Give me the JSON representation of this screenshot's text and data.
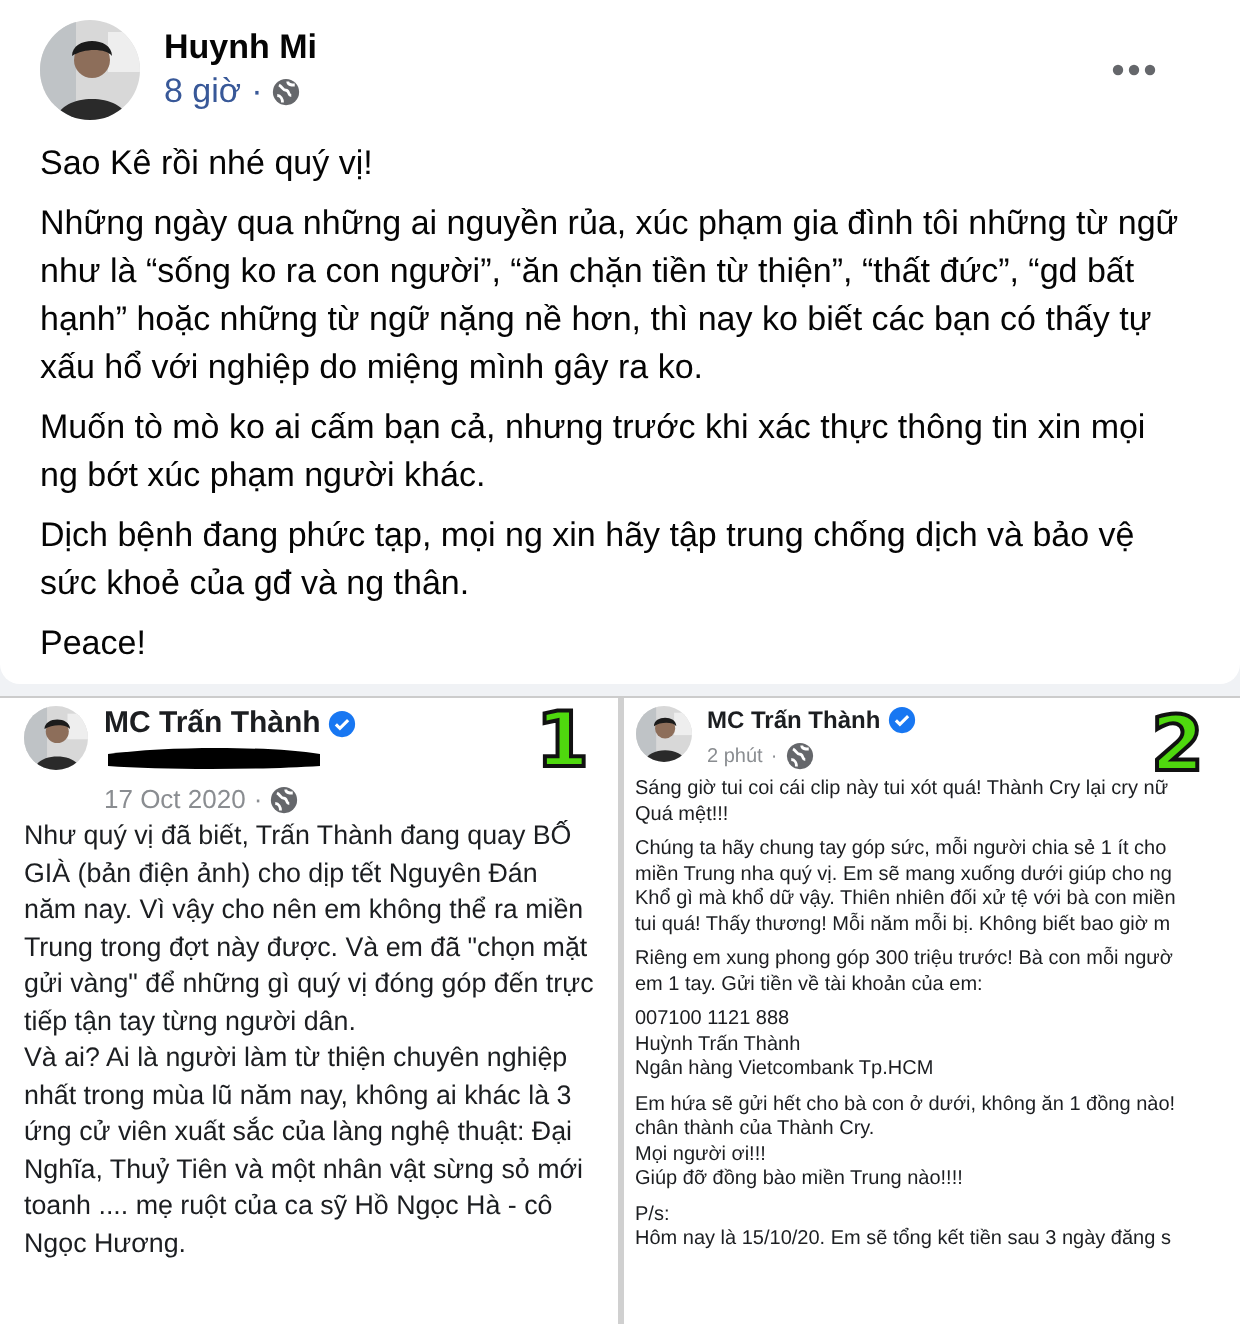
{
  "post": {
    "author": "Huynh Mi",
    "time": "8 giờ",
    "separator": "·",
    "paragraphs": [
      "Sao Kê rồi nhé quý vị!",
      "Những ngày qua những ai nguyền rủa, xúc phạm gia đình tôi những từ ngữ như là “sống ko ra con người”, “ăn chặn tiền từ thiện”, “thất đức”, “gd bất hạnh” hoặc những từ ngữ nặng nề hơn, thì nay ko biết các bạn có thấy tự xấu hổ với nghiệp do miệng mình gây ra ko.",
      "Muốn tò mò ko ai cấm bạn cả, nhưng trước khi xác thực thông tin xin mọi ng bớt xúc phạm người khác.",
      "Dịch bệnh đang phức tạp, mọi ng xin hãy tập trung chống dịch và bảo vệ sức khoẻ của gđ và ng thân.",
      "Peace!"
    ]
  },
  "screenshots": [
    {
      "marker": "1",
      "author": "MC Trấn Thành",
      "verified": true,
      "redacted": true,
      "time": "17 Oct 2020",
      "separator": "·",
      "kind": "wrapped",
      "paragraphs": [
        [
          "Như quý vị đã biết, Trấn Thành đang quay BỐ GIÀ (bản điện ảnh) cho dịp tết Nguyên Đán năm nay. Vì vậy cho nên em không thể ra miền Trung trong đợt này được. Và em đã \"chọn mặt gửi vàng\" để những gì quý vị đóng góp đến trực tiếp tận tay từng người dân."
        ],
        [
          "Và ai? Ai là người làm từ thiện chuyên nghiệp nhất trong mùa lũ năm nay, không ai khác là 3 ứng cử viên xuất sắc của làng nghệ thuật: Đại Nghĩa, Thuỷ Tiên và một nhân vật sừng sỏ mới toanh .... mẹ ruột của ca sỹ Hồ Ngọc Hà - cô Ngọc Hương."
        ]
      ]
    },
    {
      "marker": "2",
      "author": "MC Trấn Thành",
      "verified": true,
      "redacted": false,
      "time": "2 phút",
      "separator": "·",
      "kind": "lines",
      "paragraphs": [
        [
          "Sáng giờ tui coi cái clip này tui xót quá! Thành Cry lại cry nữ",
          "Quá mệt!!!"
        ],
        [
          "Chúng ta hãy chung tay góp sức, mỗi người chia sẻ 1 ít cho",
          "miền Trung nha quý vị. Em sẽ mang xuống dưới giúp cho ng",
          "Khổ gì mà khổ dữ vậy. Thiên nhiên đối xử tệ với bà con miền",
          "tui quá! Thấy thương! Mỗi năm mỗi bị. Không biết bao giờ m"
        ],
        [
          "Riêng em xung phong góp 300 triệu trước! Bà con mỗi ngườ",
          "em 1 tay. Gửi tiền về tài khoản của em:"
        ],
        [
          "007100 1121 888",
          "Huỳnh Trấn Thành",
          "Ngân hàng Vietcombank Tp.HCM"
        ],
        [
          "Em hứa sẽ gửi hết cho bà con ở dưới, không ăn 1 đồng nào!",
          "chân thành của Thành Cry.",
          "Mọi người ơi!!!",
          "Giúp đỡ đồng bào miền Trung nào!!!!"
        ],
        [
          "P/s:",
          "Hôm nay là 15/10/20. Em sẽ tổng kết tiền sau 3 ngày đăng s"
        ]
      ]
    }
  ]
}
